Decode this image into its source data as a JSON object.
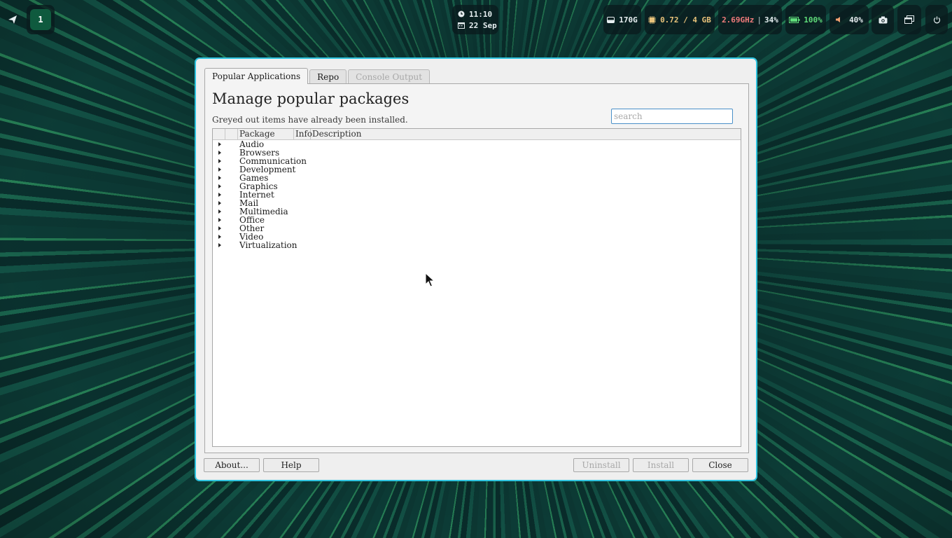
{
  "topbar": {
    "workspace": "1",
    "clock": {
      "time": "11:10",
      "date": "22 Sep"
    },
    "disk": "170G",
    "memory": "0.72 / 4 GB",
    "cpu": {
      "freq": "2.69GHz",
      "sep": "|",
      "load": "34%"
    },
    "battery": "100%",
    "volume": "40%"
  },
  "dialog": {
    "tabs": [
      {
        "label": "Popular Applications",
        "state": "active"
      },
      {
        "label": "Repo",
        "state": "normal"
      },
      {
        "label": "Console Output",
        "state": "disabled"
      }
    ],
    "heading": "Manage popular packages",
    "subheading": "Greyed out items have already been installed.",
    "search_placeholder": "search",
    "columns": [
      "",
      "",
      "Package",
      "Info",
      "Description"
    ],
    "categories": [
      "Audio",
      "Browsers",
      "Communication",
      "Development",
      "Games",
      "Graphics",
      "Internet",
      "Mail",
      "Multimedia",
      "Office",
      "Other",
      "Video",
      "Virtualization"
    ],
    "buttons": {
      "about": "About...",
      "help": "Help",
      "uninstall": "Uninstall",
      "install": "Install",
      "close": "Close"
    }
  },
  "colors": {
    "dialog_border": "#2ec4e0",
    "workspace_badge": "#0f5a3e",
    "memory_text": "#e8c27a",
    "cpu_freq_text": "#f07b7b",
    "battery_text": "#5fdc7a"
  }
}
